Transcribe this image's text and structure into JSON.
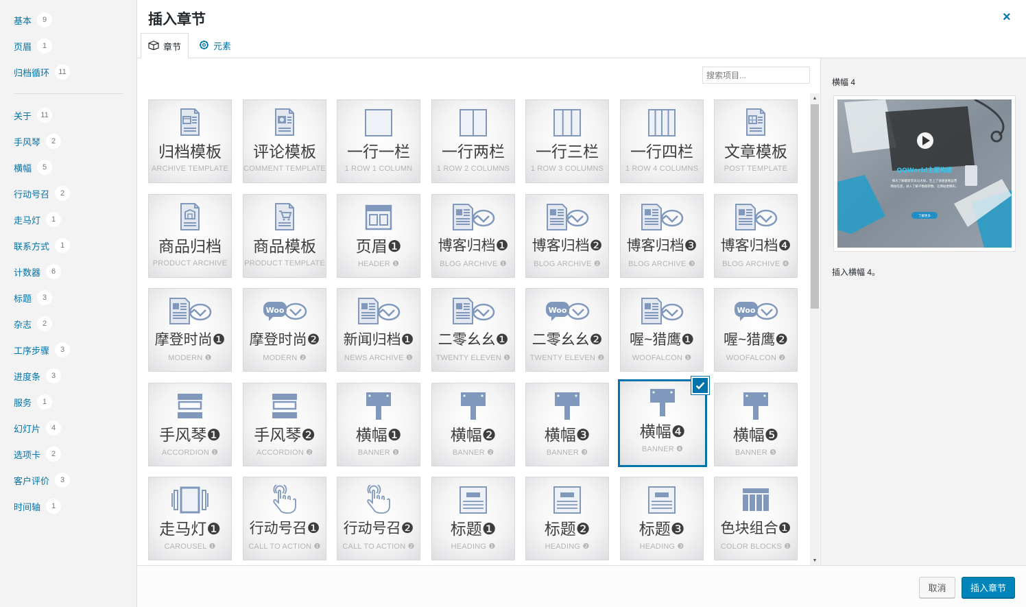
{
  "modal": {
    "title": "插入章节",
    "close_icon": "×"
  },
  "tabs": [
    {
      "label": "章节",
      "icon": "box-icon"
    },
    {
      "label": "元素",
      "icon": "gear-icon"
    }
  ],
  "search": {
    "placeholder": "搜索项目..."
  },
  "categories": [
    {
      "label": "基本",
      "count": "9"
    },
    {
      "label": "页眉",
      "count": "1"
    },
    {
      "label": "归档循环",
      "count": "11"
    },
    {
      "label": "关于",
      "count": "11"
    },
    {
      "label": "手风琴",
      "count": "2"
    },
    {
      "label": "横幅",
      "count": "5"
    },
    {
      "label": "行动号召",
      "count": "2"
    },
    {
      "label": "走马灯",
      "count": "1"
    },
    {
      "label": "联系方式",
      "count": "1"
    },
    {
      "label": "计数器",
      "count": "6"
    },
    {
      "label": "标题",
      "count": "3"
    },
    {
      "label": "杂志",
      "count": "2"
    },
    {
      "label": "工序步骤",
      "count": "3"
    },
    {
      "label": "进度条",
      "count": "3"
    },
    {
      "label": "服务",
      "count": "1"
    },
    {
      "label": "幻灯片",
      "count": "4"
    },
    {
      "label": "选项卡",
      "count": "2"
    },
    {
      "label": "客户评价",
      "count": "3"
    },
    {
      "label": "时间轴",
      "count": "1"
    }
  ],
  "sections": [
    [
      {
        "name": "归档模板",
        "sub": "ARCHIVE TEMPLATE",
        "icon": "archive-doc-icon"
      },
      {
        "name": "评论模板",
        "sub": "COMMENT TEMPLATE",
        "icon": "comment-doc-icon"
      },
      {
        "name": "一行一栏",
        "sub": "1 ROW 1 COLUMN",
        "icon": "one-column-icon"
      },
      {
        "name": "一行两栏",
        "sub": "1 ROW 2 COLUMNS",
        "icon": "two-columns-icon"
      },
      {
        "name": "一行三栏",
        "sub": "1 ROW 3 COLUMNS",
        "icon": "three-columns-icon"
      },
      {
        "name": "一行四栏",
        "sub": "1 ROW 4 COLUMNS",
        "icon": "four-columns-icon"
      },
      {
        "name": "文章模板",
        "sub": "POST TEMPLATE",
        "icon": "post-doc-icon"
      }
    ],
    [
      {
        "name": "商品归档",
        "sub": "PRODUCT ARCHIVE",
        "icon": "product-archive-icon"
      },
      {
        "name": "商品模板",
        "sub": "PRODUCT TEMPLATE",
        "icon": "product-template-icon"
      },
      {
        "name": "页眉❶",
        "sub": "HEADER ❶",
        "icon": "header-layout-icon"
      },
      {
        "name": "博客归档❶",
        "sub": "BLOG ARCHIVE ❶",
        "icon": "blog-archive-icon"
      },
      {
        "name": "博客归档❷",
        "sub": "BLOG ARCHIVE ❷",
        "icon": "blog-archive-icon"
      },
      {
        "name": "博客归档❸",
        "sub": "BLOG ARCHIVE ❸",
        "icon": "blog-archive-icon"
      },
      {
        "name": "博客归档❹",
        "sub": "BLOG ARCHIVE ❹",
        "icon": "blog-archive-icon"
      }
    ],
    [
      {
        "name": "摩登时尚❶",
        "sub": "MODERN ❶",
        "icon": "blog-archive-icon"
      },
      {
        "name": "摩登时尚❷",
        "sub": "MODERN ❷",
        "icon": "woo-archive-icon"
      },
      {
        "name": "新闻归档❶",
        "sub": "NEWS ARCHIVE ❶",
        "icon": "blog-archive-icon"
      },
      {
        "name": "二零幺幺❶",
        "sub": "TWENTY ELEVEN ❶",
        "icon": "blog-archive-icon"
      },
      {
        "name": "二零幺幺❷",
        "sub": "TWENTY ELEVEN ❷",
        "icon": "woo-archive-icon"
      },
      {
        "name": "喔~猎鹰❶",
        "sub": "WOOFALCON ❶",
        "icon": "blog-archive-icon"
      },
      {
        "name": "喔~猎鹰❷",
        "sub": "WOOFALCON ❷",
        "icon": "woo-archive-icon"
      }
    ],
    [
      {
        "name": "手风琴❶",
        "sub": "ACCORDION ❶",
        "icon": "accordion-icon"
      },
      {
        "name": "手风琴❷",
        "sub": "ACCORDION ❷",
        "icon": "accordion-icon"
      },
      {
        "name": "横幅❶",
        "sub": "BANNER ❶",
        "icon": "banner-sign-icon"
      },
      {
        "name": "横幅❷",
        "sub": "BANNER ❷",
        "icon": "banner-sign-icon"
      },
      {
        "name": "横幅❸",
        "sub": "BANNER ❸",
        "icon": "banner-sign-icon"
      },
      {
        "name": "横幅❹",
        "sub": "BANNER ❹",
        "icon": "banner-sign-icon",
        "selected": true
      },
      {
        "name": "横幅❺",
        "sub": "BANNER ❺",
        "icon": "banner-sign-icon"
      }
    ],
    [
      {
        "name": "走马灯❶",
        "sub": "CAROUSEL ❶",
        "icon": "carousel-icon"
      },
      {
        "name": "行动号召❶",
        "sub": "CALL TO ACTION ❶",
        "icon": "hand-tap-icon"
      },
      {
        "name": "行动号召❷",
        "sub": "CALL TO ACTION ❷",
        "icon": "hand-tap-icon"
      },
      {
        "name": "标题❶",
        "sub": "HEADING ❶",
        "icon": "heading-icon"
      },
      {
        "name": "标题❷",
        "sub": "HEADING ❷",
        "icon": "heading-icon"
      },
      {
        "name": "标题❸",
        "sub": "HEADING ❸",
        "icon": "heading-icon"
      },
      {
        "name": "色块组合❶",
        "sub": "COLOR BLOCKS ❶",
        "icon": "color-blocks-icon"
      }
    ]
  ],
  "detail": {
    "title": "横幅 4",
    "preview_headline": "QQWorld主题构建",
    "preview_text_1": "每天了解最新资讯与大局，至上了快速查看运营",
    "preview_text_2": "网站信息，进入了解子数据参数，让网站更精彩。",
    "preview_button": "了解更多",
    "description": "插入横幅 4。"
  },
  "footer": {
    "cancel_label": "取消",
    "insert_label": "插入章节"
  },
  "colors": {
    "accent": "#0073aa",
    "primary_button": "#0085ba",
    "icon": "#7f98bb",
    "preview_accent": "#2bb3d6"
  }
}
